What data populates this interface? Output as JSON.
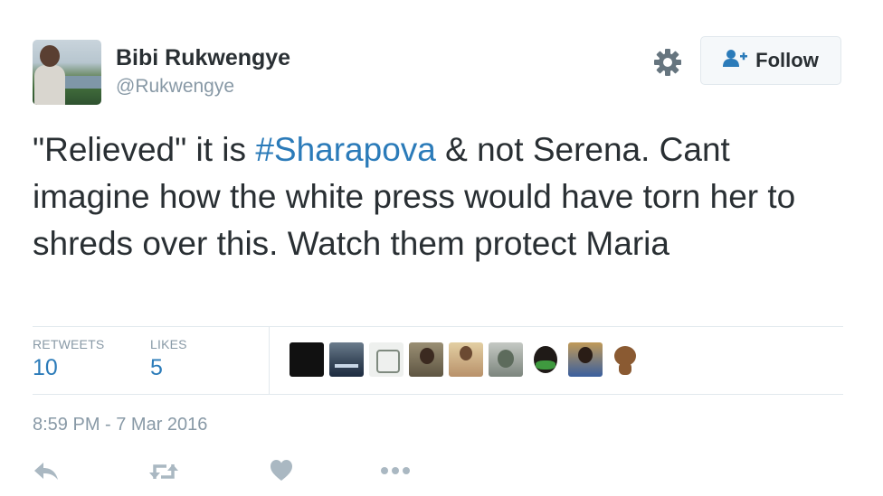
{
  "author": {
    "display_name": "Bibi Rukwengye",
    "screen_name": "@Rukwengye"
  },
  "header": {
    "settings_icon": "gear-icon",
    "follow_label": "Follow",
    "follow_icon": "person-plus-icon"
  },
  "tweet": {
    "text_before": "\"Relieved\" it is ",
    "hashtag": "#Sharapova",
    "text_after": " & not Serena. Cant imagine how the white press would have torn her to shreds over this. Watch them protect Maria"
  },
  "stats": {
    "retweets_label": "RETWEETS",
    "retweets_count": "10",
    "likes_label": "LIKES",
    "likes_count": "5"
  },
  "likers_count_shown": 9,
  "timestamp": "8:59 PM - 7 Mar 2016",
  "actions": [
    "reply-icon",
    "retweet-icon",
    "like-icon",
    "more-icon"
  ],
  "colors": {
    "link": "#2b7bb9",
    "muted": "#8899a6",
    "text": "#292f33",
    "divider": "#e1e8ed"
  }
}
